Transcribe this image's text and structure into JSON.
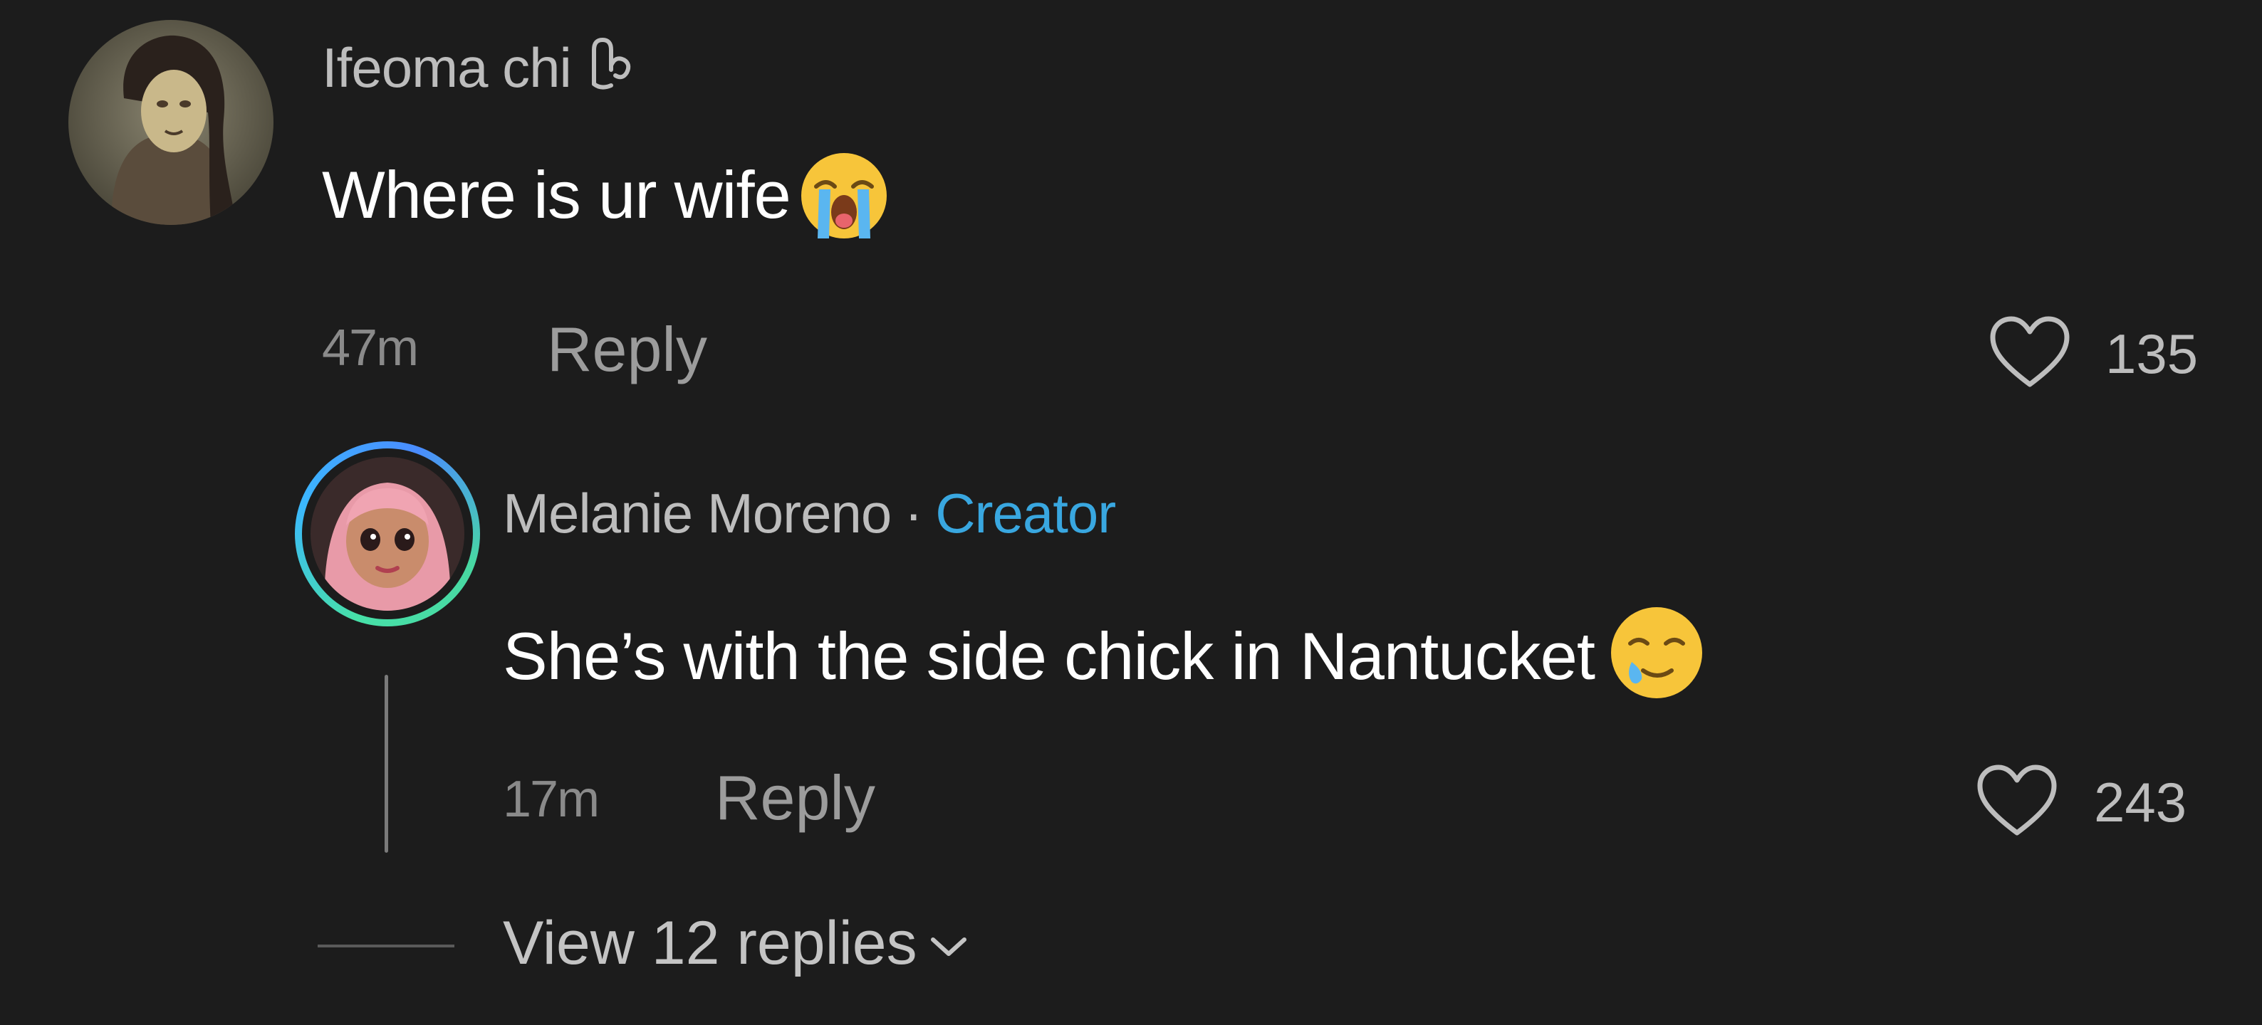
{
  "comment": {
    "username": "Ifeoma chi",
    "text": "Where is ur wife",
    "emoji": "loudly-crying-face",
    "time": "47m",
    "reply_label": "Reply",
    "likes": "135",
    "replies": [
      {
        "username": "Melanie Moreno",
        "separator": "·",
        "badge": "Creator",
        "text": "She’s with the side chick in Nantucket",
        "emoji": "smiling-face-with-tear",
        "time": "17m",
        "reply_label": "Reply",
        "likes": "243"
      }
    ],
    "view_replies_label": "View 12 replies"
  },
  "colors": {
    "background": "#1c1c1c",
    "creator_badge": "#39a7e0",
    "creator_ring": "#47e0a8"
  }
}
